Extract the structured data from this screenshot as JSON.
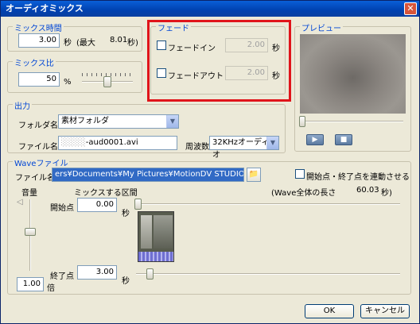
{
  "window": {
    "title": "オーディオミックス",
    "close_glyph": "✕"
  },
  "mix_time": {
    "group_label": "ミックス時間",
    "value": "3.00",
    "unit": "秒",
    "max_label": "(最大",
    "max_value": "8.01",
    "max_unit": "秒)"
  },
  "mix_ratio": {
    "group_label": "ミックス比",
    "value": "50",
    "unit": "%",
    "slider_fraction": 0.5
  },
  "fade": {
    "group_label": "フェード",
    "fade_in_label": "フェードイン",
    "fade_in_value": "2.00",
    "fade_in_unit": "秒",
    "fade_out_label": "フェードアウト",
    "fade_out_value": "2.00",
    "fade_out_unit": "秒"
  },
  "preview": {
    "group_label": "プレビュー",
    "play_glyph": "▶",
    "stop_glyph": "■"
  },
  "output": {
    "group_label": "出力",
    "folder_label": "フォルダ名",
    "folder_value": "素材フォルダ",
    "file_label": "ファイル名",
    "file_value": "-aud0001.avi",
    "freq_label": "周波数",
    "freq_value": "32KHzオーディオ"
  },
  "wave": {
    "group_label": "Waveファイル",
    "file_label": "ファイル名",
    "file_path": "ers¥Documents¥My Pictures¥MotionDV STUDIO¥発表会.mbm",
    "link_label": "開始点・終了点を連動させる",
    "volume_label": "音量",
    "section_label": "ミックスする区間",
    "length_label": "(Wave全体の長さ",
    "length_value": "60.03",
    "length_unit": "秒)",
    "start_label": "開始点",
    "start_value": "0.00",
    "start_unit": "秒",
    "end_label": "終了点",
    "end_value": "3.00",
    "end_unit": "秒",
    "volume_value": "1.00",
    "volume_unit": "倍"
  },
  "buttons": {
    "ok": "OK",
    "cancel": "キャンセル"
  }
}
